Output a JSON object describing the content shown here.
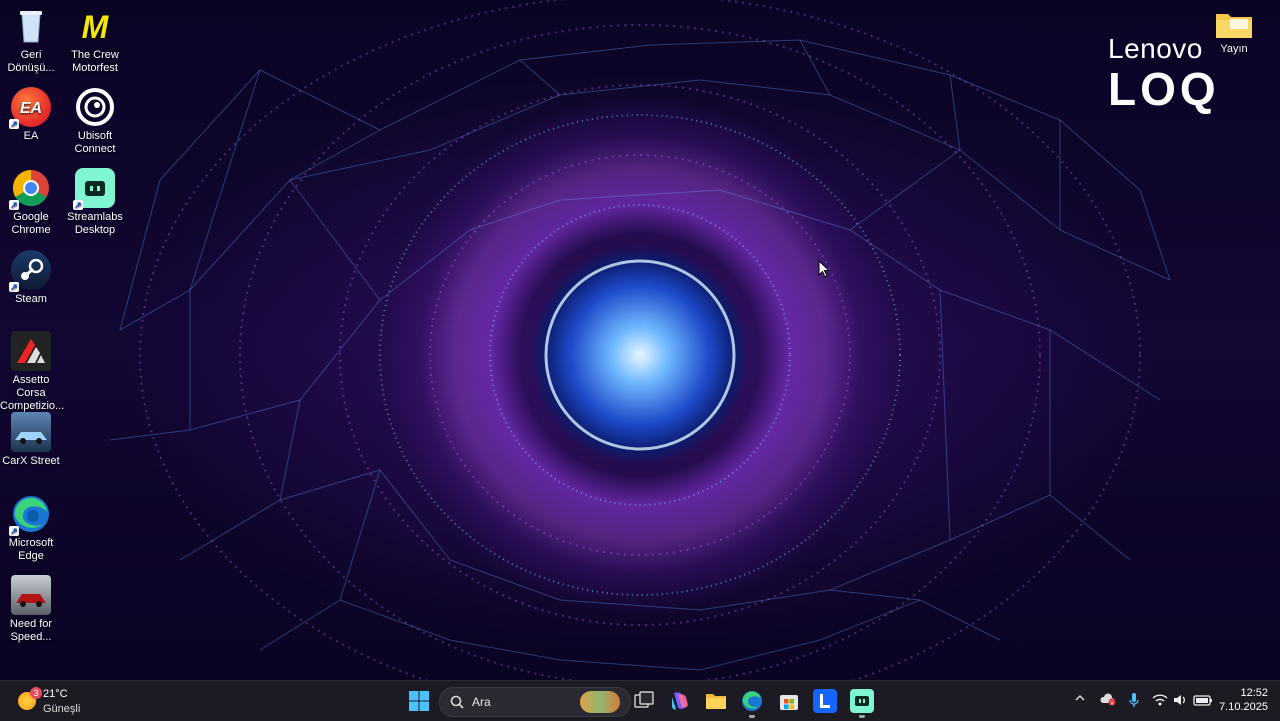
{
  "brand": {
    "line1": "Lenovo",
    "line2": "LOQ"
  },
  "desktop_icons": [
    {
      "label": "Geri Dönüşü...",
      "icon": "recycle-bin-icon"
    },
    {
      "label": "The Crew Motorfest",
      "icon": "the-crew-icon"
    },
    {
      "label": "EA",
      "icon": "ea-icon"
    },
    {
      "label": "Ubisoft Connect",
      "icon": "ubisoft-icon"
    },
    {
      "label": "Google Chrome",
      "icon": "chrome-icon"
    },
    {
      "label": "Streamlabs Desktop",
      "icon": "streamlabs-icon"
    },
    {
      "label": "Steam",
      "icon": "steam-icon"
    },
    {
      "label": "Assetto Corsa Competizio...",
      "icon": "assetto-corsa-icon"
    },
    {
      "label": "CarX Street",
      "icon": "carx-street-icon"
    },
    {
      "label": "Microsoft Edge",
      "icon": "edge-icon"
    },
    {
      "label": "Need for Speed...",
      "icon": "need-for-speed-icon"
    },
    {
      "label": "Yayın",
      "icon": "folder-icon"
    }
  ],
  "taskbar": {
    "weather": {
      "temp": "21°C",
      "condition": "Güneşli",
      "badge": "3"
    },
    "search_placeholder": "Ara",
    "time": "12:52",
    "date": "7.10.2025"
  },
  "colors": {
    "accent": "#4fb0ff",
    "taskbar": "#1c1b23",
    "wallpaper_glow": "#9a3cf0"
  }
}
